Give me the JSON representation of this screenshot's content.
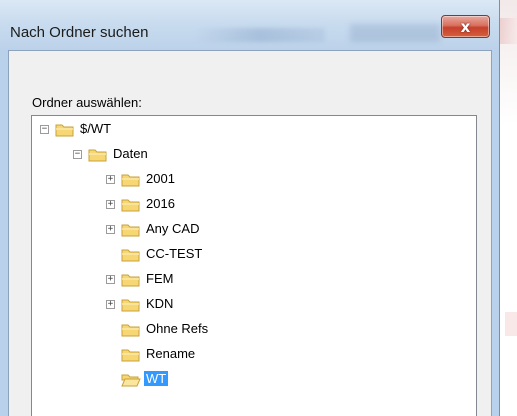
{
  "window": {
    "title": "Nach Ordner suchen",
    "close_glyph": "x"
  },
  "dialog": {
    "label": "Ordner auswählen:"
  },
  "tree": {
    "items": [
      {
        "label": "$/WT",
        "level": 0,
        "expander": "minus",
        "selected": false,
        "open": false
      },
      {
        "label": "Daten",
        "level": 1,
        "expander": "minus",
        "selected": false,
        "open": false
      },
      {
        "label": "2001",
        "level": 2,
        "expander": "plus",
        "selected": false,
        "open": false
      },
      {
        "label": "2016",
        "level": 2,
        "expander": "plus",
        "selected": false,
        "open": false
      },
      {
        "label": "Any CAD",
        "level": 2,
        "expander": "plus",
        "selected": false,
        "open": false
      },
      {
        "label": "CC-TEST",
        "level": 2,
        "expander": "none",
        "selected": false,
        "open": false
      },
      {
        "label": "FEM",
        "level": 2,
        "expander": "plus",
        "selected": false,
        "open": false
      },
      {
        "label": "KDN",
        "level": 2,
        "expander": "plus",
        "selected": false,
        "open": false
      },
      {
        "label": "Ohne Refs",
        "level": 2,
        "expander": "none",
        "selected": false,
        "open": false
      },
      {
        "label": "Rename",
        "level": 2,
        "expander": "none",
        "selected": false,
        "open": false
      },
      {
        "label": "WT",
        "level": 2,
        "expander": "none",
        "selected": true,
        "open": true
      }
    ]
  },
  "colors": {
    "selection": "#3399ff",
    "folder_fill": "#f7d774",
    "folder_stroke": "#c9a23b",
    "close_button": "#c6402b"
  }
}
